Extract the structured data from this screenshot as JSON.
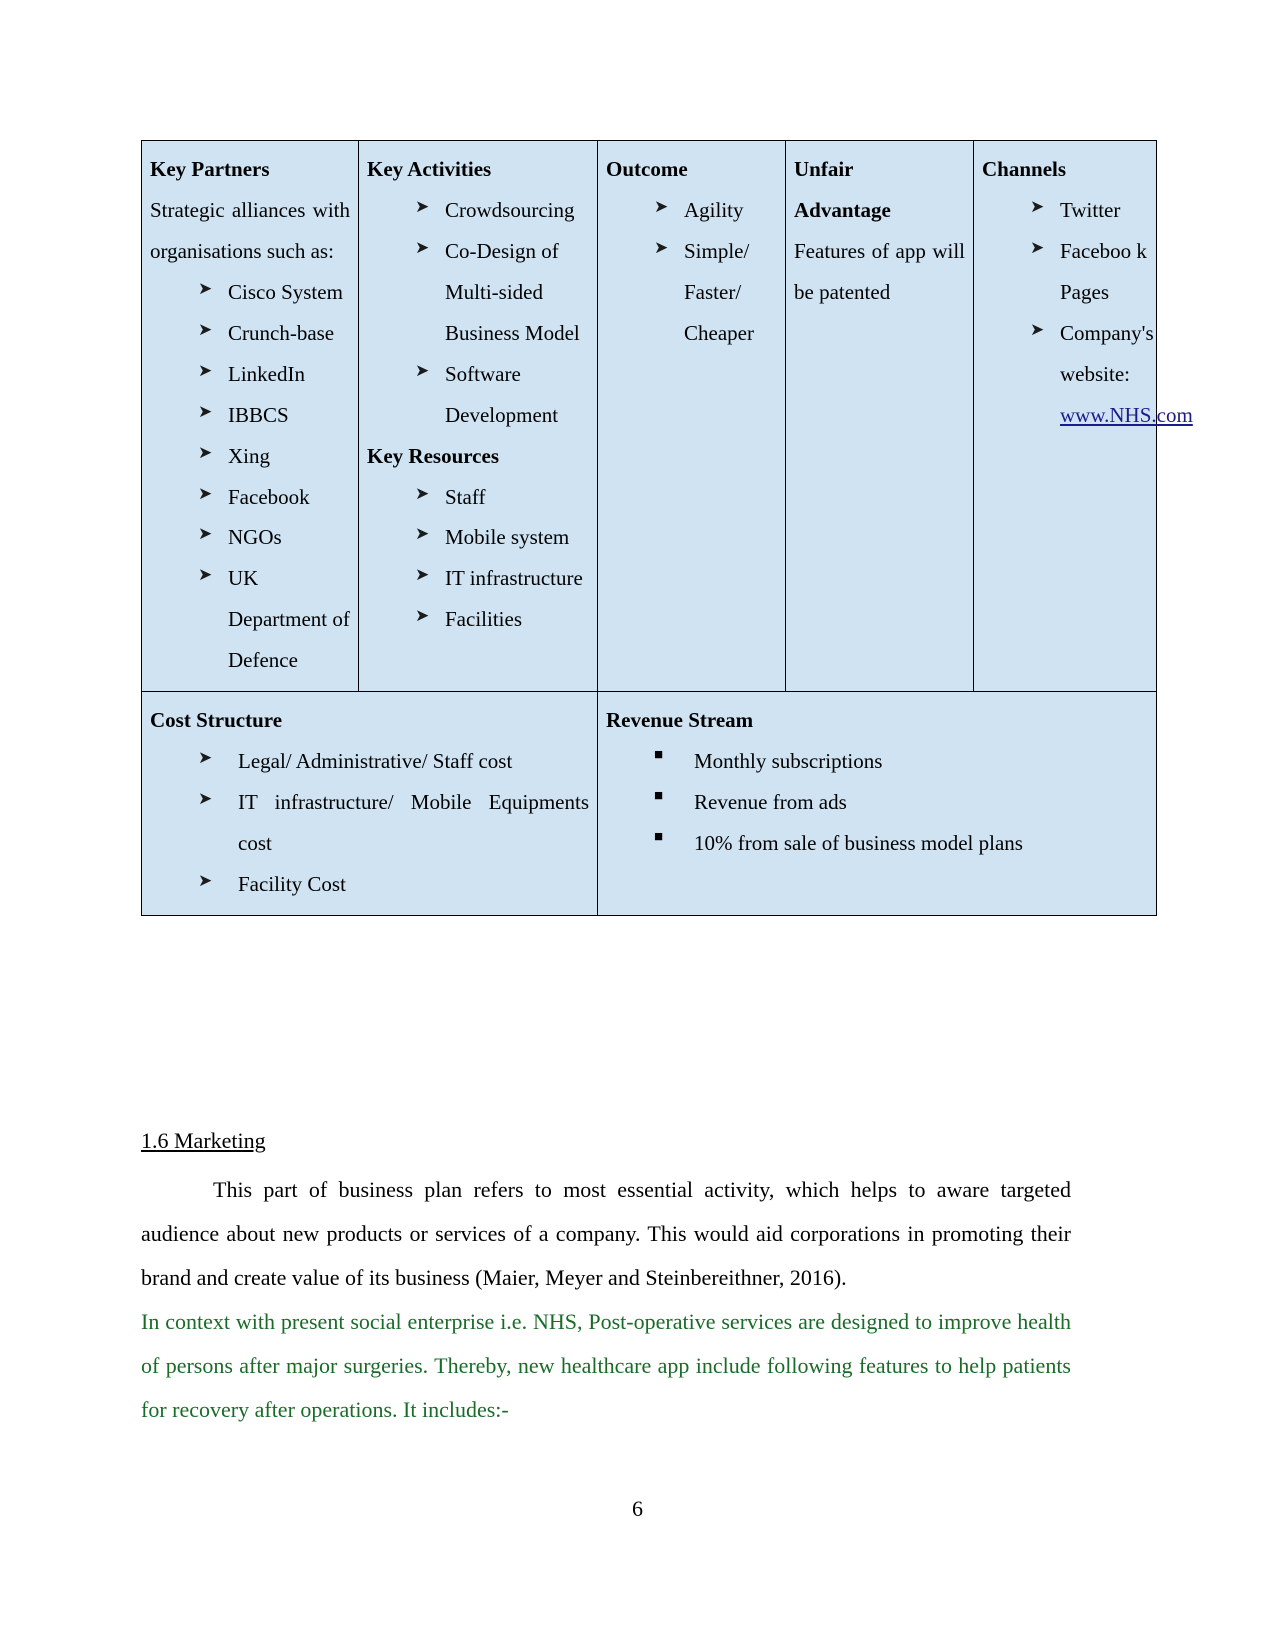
{
  "document": {
    "page_number": "6"
  },
  "canvas": {
    "key_partners": {
      "title": "Key Partners",
      "intro": "Strategic alliances with organisations such as:",
      "items": [
        "Cisco System",
        "Crunch-base",
        "LinkedIn",
        "IBBCS",
        "Xing",
        "Facebook",
        "NGOs",
        "UK Department of Defence"
      ]
    },
    "key_activities": {
      "title": "Key Activities",
      "items": [
        "Crowdsourcing",
        "Co-Design of Multi-sided Business Model",
        "Software Development"
      ]
    },
    "key_resources": {
      "title": "Key Resources",
      "items": [
        "Staff",
        "Mobile system",
        "IT infrastructure",
        "Facilities"
      ]
    },
    "outcome": {
      "title": "Outcome",
      "items": [
        "Agility",
        "Simple/ Faster/ Cheaper"
      ]
    },
    "unfair_advantage": {
      "title_line1": "Unfair",
      "title_line2": "Advantage",
      "body": "Features of app will be patented"
    },
    "channels": {
      "title": "Channels",
      "items": [
        "Twitter",
        "Faceboo k Pages"
      ],
      "website_item_label": "Company's website:",
      "website_link": "www.NHS.com"
    },
    "cost_structure": {
      "title": "Cost Structure",
      "items": [
        "Legal/ Administrative/ Staff cost",
        "IT infrastructure/ Mobile Equipments cost",
        "Facility Cost"
      ]
    },
    "revenue_stream": {
      "title": "Revenue Stream",
      "items": [
        "Monthly subscriptions",
        "Revenue from ads",
        "10% from sale of business model plans"
      ]
    }
  },
  "section": {
    "heading": "1.6 Marketing",
    "paragraph_black": "This part of business plan refers to most essential activity, which helps to aware targeted audience about new products or services of a company. This would aid corporations in promoting their brand and create value of its business (Maier, Meyer and Steinbereithner, 2016).",
    "paragraph_green": "In context with present social enterprise i.e. NHS, Post-operative services are designed to improve health of persons after major surgeries. Thereby, new healthcare app include following features to help patients for recovery after operations. It includes:-"
  },
  "colors": {
    "table_fill": "#cfe3f2",
    "link": "#1b1b8f",
    "green_text": "#1a6b28"
  }
}
